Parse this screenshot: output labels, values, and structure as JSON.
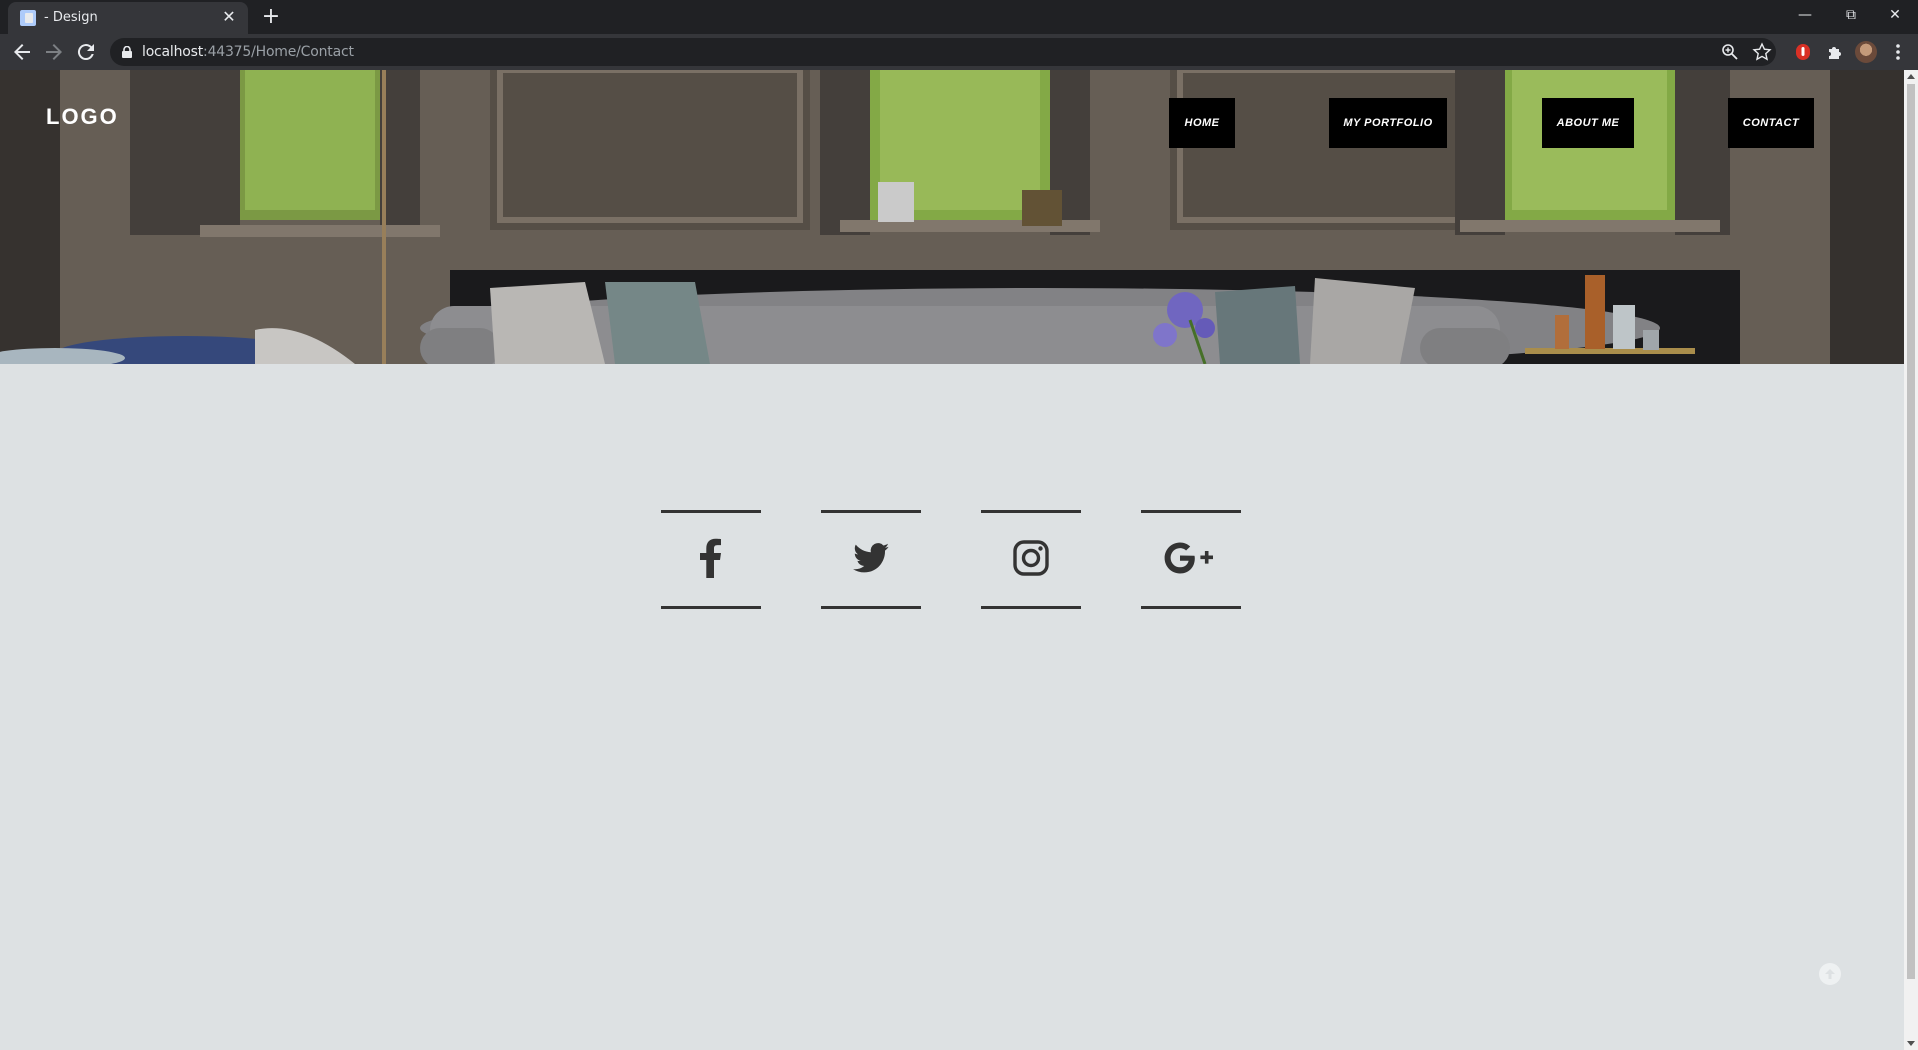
{
  "browser": {
    "tab_title": "- Design",
    "url_host": "localhost",
    "url_rest": ":44375/Home/Contact"
  },
  "site": {
    "logo": "LOGO",
    "nav": [
      {
        "label": "HOME"
      },
      {
        "label": "MY PORTFOLIO"
      },
      {
        "label": "ABOUT ME"
      },
      {
        "label": "CONTACT"
      }
    ],
    "social": [
      {
        "icon": "facebook-icon"
      },
      {
        "icon": "twitter-icon"
      },
      {
        "icon": "instagram-icon"
      },
      {
        "icon": "google-plus-icon"
      }
    ]
  },
  "colors": {
    "page_bg": "#dde1e3",
    "nav_bg": "#000000",
    "social_line": "#333333"
  }
}
